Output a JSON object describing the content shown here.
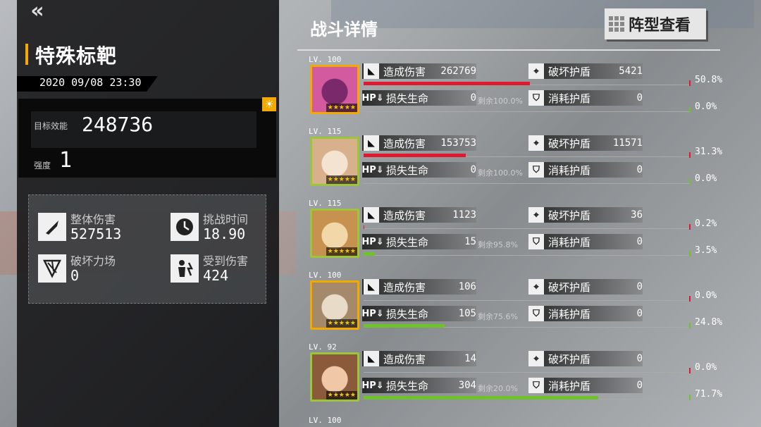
{
  "left": {
    "back_icon": "double-chevron-left-icon",
    "title": "特殊标靶",
    "date": "2020 09/08 23:30",
    "efficiency_label": "目标效能",
    "efficiency_value": "248736",
    "strength_label": "强度",
    "strength_value": "1",
    "stats": [
      {
        "label": "整体伤害",
        "value": "527513",
        "icon": "bullet-icon"
      },
      {
        "label": "挑战时间",
        "value": "18.90",
        "icon": "clock-icon"
      },
      {
        "label": "破坏力场",
        "value": "0",
        "icon": "broken-shield-icon"
      },
      {
        "label": "受到伤害",
        "value": "424",
        "icon": "hit-figure-icon"
      }
    ]
  },
  "right": {
    "title": "战斗详情",
    "formation_button": "阵型查看",
    "labels": {
      "damage": "造成伤害",
      "hp_lost": "损失生命",
      "shield_break": "破坏护盾",
      "shield_use": "消耗护盾",
      "hp_tag": "HP"
    },
    "units": [
      {
        "level": "LV. 100",
        "damage": "262769",
        "hp_lost": "0",
        "remain": "剩余100.0%",
        "shield_break": "5421",
        "shield_use": "0",
        "damage_pct": "50.8%",
        "hp_pct": "0.0%",
        "damage_frac": 0.508,
        "hp_frac": 0.0,
        "frame": "gold"
      },
      {
        "level": "LV. 115",
        "damage": "153753",
        "hp_lost": "0",
        "remain": "剩余100.0%",
        "shield_break": "11571",
        "shield_use": "0",
        "damage_pct": "31.3%",
        "hp_pct": "0.0%",
        "damage_frac": 0.313,
        "hp_frac": 0.0,
        "frame": "green"
      },
      {
        "level": "LV. 115",
        "damage": "1123",
        "hp_lost": "15",
        "remain": "剩余95.8%",
        "shield_break": "36",
        "shield_use": "0",
        "damage_pct": "0.2%",
        "hp_pct": "3.5%",
        "damage_frac": 0.002,
        "hp_frac": 0.035,
        "frame": "green"
      },
      {
        "level": "LV. 100",
        "damage": "106",
        "hp_lost": "105",
        "remain": "剩余75.6%",
        "shield_break": "0",
        "shield_use": "0",
        "damage_pct": "0.0%",
        "hp_pct": "24.8%",
        "damage_frac": 0.0,
        "hp_frac": 0.248,
        "frame": "gold"
      },
      {
        "level": "LV. 92",
        "damage": "14",
        "hp_lost": "304",
        "remain": "剩余20.0%",
        "shield_break": "0",
        "shield_use": "0",
        "damage_pct": "0.0%",
        "hp_pct": "71.7%",
        "damage_frac": 0.0,
        "hp_frac": 0.717,
        "frame": "green"
      }
    ],
    "next_level": "LV. 100"
  },
  "colors": {
    "accent_orange": "#f2a900",
    "damage_red": "#e0192f",
    "hp_green": "#6fc32a"
  }
}
